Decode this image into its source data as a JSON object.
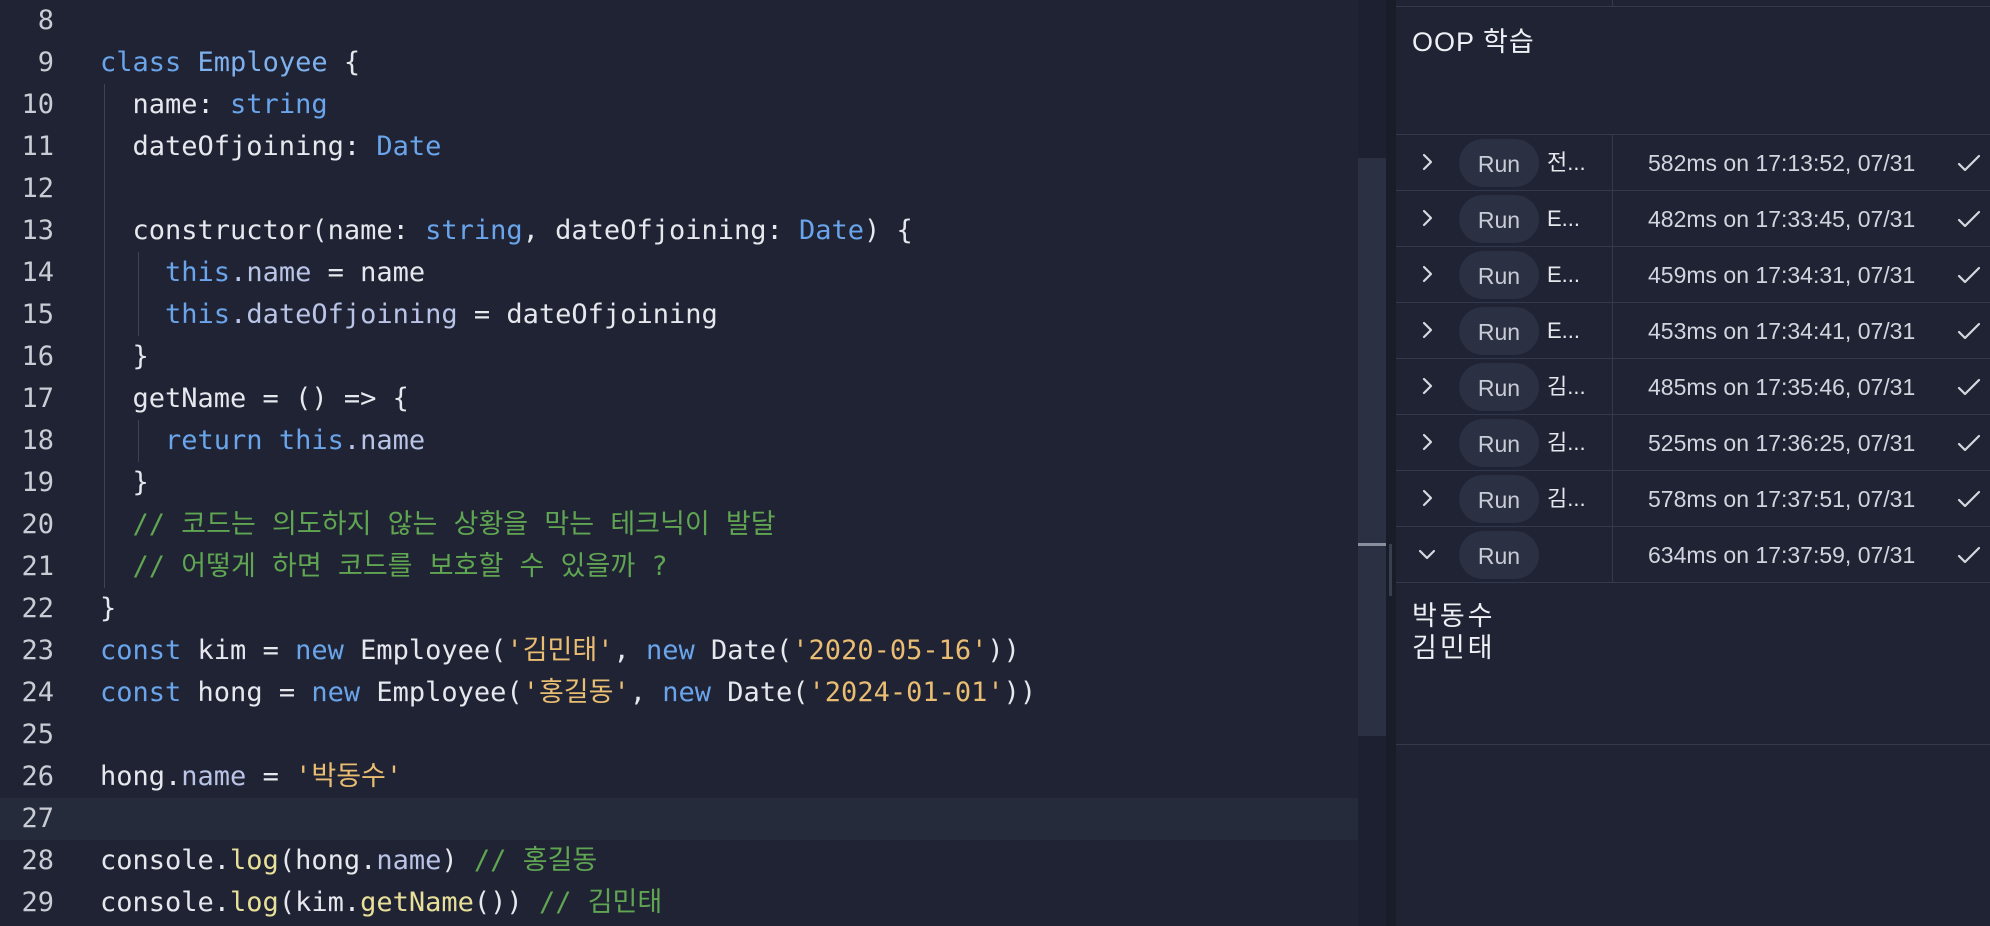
{
  "editor": {
    "lines": [
      {
        "n": "8",
        "tokens": []
      },
      {
        "n": "9",
        "tokens": [
          {
            "t": "class ",
            "c": "kw"
          },
          {
            "t": "Employee",
            "c": "cls"
          },
          {
            "t": " {",
            "c": "pl"
          }
        ]
      },
      {
        "n": "10",
        "tokens": [
          {
            "t": "  name: ",
            "c": "pl"
          },
          {
            "t": "string",
            "c": "ty"
          }
        ]
      },
      {
        "n": "11",
        "tokens": [
          {
            "t": "  dateOfjoining: ",
            "c": "pl"
          },
          {
            "t": "Date",
            "c": "ty"
          }
        ]
      },
      {
        "n": "12",
        "tokens": []
      },
      {
        "n": "13",
        "tokens": [
          {
            "t": "  constructor(name: ",
            "c": "pl"
          },
          {
            "t": "string",
            "c": "ty"
          },
          {
            "t": ", dateOfjoining: ",
            "c": "pl"
          },
          {
            "t": "Date",
            "c": "ty"
          },
          {
            "t": ") {",
            "c": "pl"
          }
        ]
      },
      {
        "n": "14",
        "tokens": [
          {
            "t": "    ",
            "c": "pl"
          },
          {
            "t": "this",
            "c": "kw"
          },
          {
            "t": ".name",
            "c": "prop"
          },
          {
            "t": " = name",
            "c": "pl"
          }
        ]
      },
      {
        "n": "15",
        "tokens": [
          {
            "t": "    ",
            "c": "pl"
          },
          {
            "t": "this",
            "c": "kw"
          },
          {
            "t": ".dateOfjoining",
            "c": "prop"
          },
          {
            "t": " = dateOfjoining",
            "c": "pl"
          }
        ]
      },
      {
        "n": "16",
        "tokens": [
          {
            "t": "  }",
            "c": "pl"
          }
        ]
      },
      {
        "n": "17",
        "tokens": [
          {
            "t": "  getName = () => {",
            "c": "pl"
          }
        ]
      },
      {
        "n": "18",
        "tokens": [
          {
            "t": "    ",
            "c": "pl"
          },
          {
            "t": "return this",
            "c": "kw"
          },
          {
            "t": ".name",
            "c": "prop"
          }
        ]
      },
      {
        "n": "19",
        "tokens": [
          {
            "t": "  }",
            "c": "pl"
          }
        ]
      },
      {
        "n": "20",
        "tokens": [
          {
            "t": "  // 코드는 의도하지 않는 상황을 막는 테크닉이 발달",
            "c": "cm"
          }
        ]
      },
      {
        "n": "21",
        "tokens": [
          {
            "t": "  // 어떻게 하면 코드를 보호할 수 있을까 ?",
            "c": "cm"
          }
        ]
      },
      {
        "n": "22",
        "tokens": [
          {
            "t": "}",
            "c": "pl"
          }
        ]
      },
      {
        "n": "23",
        "tokens": [
          {
            "t": "const ",
            "c": "kw"
          },
          {
            "t": "kim = ",
            "c": "pl"
          },
          {
            "t": "new ",
            "c": "kw"
          },
          {
            "t": "Employee(",
            "c": "pl"
          },
          {
            "t": "'김민태'",
            "c": "str"
          },
          {
            "t": ", ",
            "c": "pl"
          },
          {
            "t": "new ",
            "c": "kw"
          },
          {
            "t": "Date(",
            "c": "pl"
          },
          {
            "t": "'2020-05-16'",
            "c": "str"
          },
          {
            "t": "))",
            "c": "pl"
          }
        ]
      },
      {
        "n": "24",
        "tokens": [
          {
            "t": "const ",
            "c": "kw"
          },
          {
            "t": "hong = ",
            "c": "pl"
          },
          {
            "t": "new ",
            "c": "kw"
          },
          {
            "t": "Employee(",
            "c": "pl"
          },
          {
            "t": "'홍길동'",
            "c": "str"
          },
          {
            "t": ", ",
            "c": "pl"
          },
          {
            "t": "new ",
            "c": "kw"
          },
          {
            "t": "Date(",
            "c": "pl"
          },
          {
            "t": "'2024-01-01'",
            "c": "str"
          },
          {
            "t": "))",
            "c": "pl"
          }
        ]
      },
      {
        "n": "25",
        "tokens": []
      },
      {
        "n": "26",
        "tokens": [
          {
            "t": "hong.",
            "c": "pl"
          },
          {
            "t": "name",
            "c": "prop"
          },
          {
            "t": " = ",
            "c": "pl"
          },
          {
            "t": "'박동수'",
            "c": "str"
          }
        ]
      },
      {
        "n": "27",
        "tokens": [],
        "active": true
      },
      {
        "n": "28",
        "tokens": [
          {
            "t": "console.",
            "c": "pl"
          },
          {
            "t": "log",
            "c": "fn"
          },
          {
            "t": "(hong.",
            "c": "pl"
          },
          {
            "t": "name",
            "c": "prop"
          },
          {
            "t": ") ",
            "c": "pl"
          },
          {
            "t": "// 홍길동",
            "c": "cm"
          }
        ]
      },
      {
        "n": "29",
        "tokens": [
          {
            "t": "console.",
            "c": "pl"
          },
          {
            "t": "log",
            "c": "fn"
          },
          {
            "t": "(kim.",
            "c": "pl"
          },
          {
            "t": "getName",
            "c": "fn"
          },
          {
            "t": "()) ",
            "c": "pl"
          },
          {
            "t": "// 김민태",
            "c": "cm"
          }
        ]
      }
    ]
  },
  "panel": {
    "title": "OOP 학습",
    "run_label": "Run",
    "runs": [
      {
        "name": "전...",
        "timing": "582ms on 17:13:52, 07/31",
        "expanded": false
      },
      {
        "name": "E...",
        "timing": "482ms on 17:33:45, 07/31",
        "expanded": false
      },
      {
        "name": "E...",
        "timing": "459ms on 17:34:31, 07/31",
        "expanded": false
      },
      {
        "name": "E...",
        "timing": "453ms on 17:34:41, 07/31",
        "expanded": false
      },
      {
        "name": "김...",
        "timing": "485ms on 17:35:46, 07/31",
        "expanded": false
      },
      {
        "name": "김...",
        "timing": "525ms on 17:36:25, 07/31",
        "expanded": false
      },
      {
        "name": "김...",
        "timing": "578ms on 17:37:51, 07/31",
        "expanded": false
      },
      {
        "name": "",
        "timing": "634ms on 17:37:59, 07/31",
        "expanded": true
      }
    ],
    "output": [
      "박동수",
      "김민태"
    ]
  },
  "icons": {
    "collapsed": "chevron-right-icon",
    "expanded": "chevron-down-icon",
    "status": "checkmark-icon"
  },
  "colors": {
    "background": "#1f2333",
    "keyword": "#6aa5ec",
    "string": "#e9bd72",
    "comment": "#5fa552",
    "function": "#e8e09a"
  }
}
